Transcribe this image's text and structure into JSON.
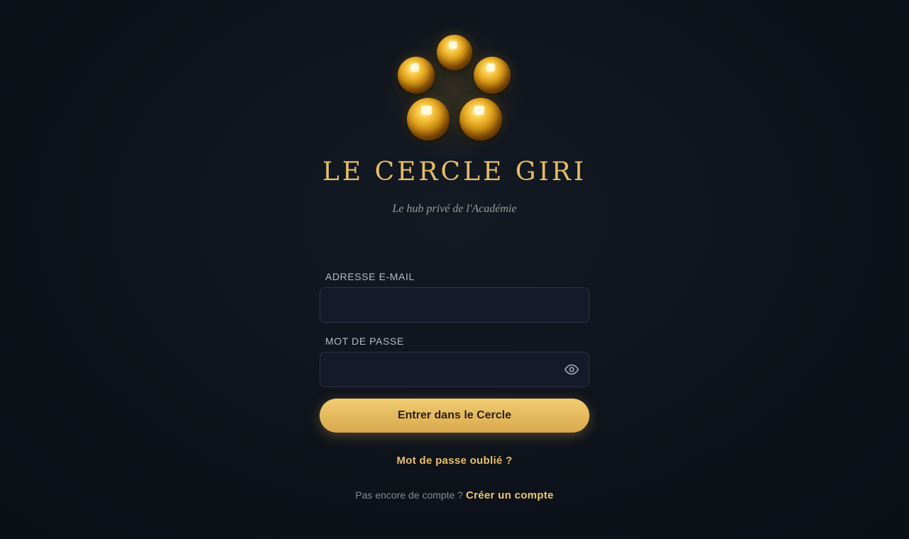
{
  "brand": {
    "title": "LE CERCLE GIRI",
    "tagline": "Le hub privé de l'Académie",
    "logo_icon": "golden-spheres-logo",
    "accent_color": "#e7bd66"
  },
  "form": {
    "email_label": "ADRESSE E-MAIL",
    "email_value": "",
    "password_label": "MOT DE PASSE",
    "password_value": "",
    "password_toggle_icon": "eye-icon",
    "submit_label": "Entrer dans le Cercle",
    "forgot_label": "Mot de passe oublié ?"
  },
  "signup": {
    "prompt": "Pas encore de compte ?",
    "link_label": "Créer un compte"
  }
}
